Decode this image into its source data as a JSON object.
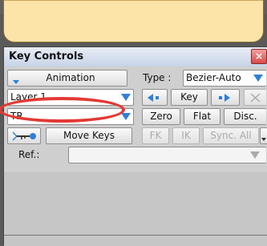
{
  "window": {
    "title": "Key Controls",
    "close_label": "×"
  },
  "rows": {
    "animation_label": "Animation",
    "type_label": "Type :",
    "type_value": "Bezier-Auto",
    "layer_value": "Layer  1",
    "key_label": "Key",
    "tr_value": "TR",
    "zero_label": "Zero",
    "flat_label": "Flat",
    "disc_label": "Disc.",
    "move_keys_label": "Move Keys",
    "fk_label": "FK",
    "ik_label": "IK",
    "sync_all_label": "Sync. All",
    "ref_label": "Ref.:",
    "ref_value": ""
  },
  "colors": {
    "accent_blue": "#2f7fd6",
    "highlight_ring": "#e23a34",
    "callout_bg": "#fce4a8"
  },
  "icons": {
    "dropdown": "triangle-down-icon",
    "prev_key": "prev-key-icon",
    "next_key": "next-key-icon",
    "delete": "x-icon",
    "key_tool": "key-icon"
  }
}
